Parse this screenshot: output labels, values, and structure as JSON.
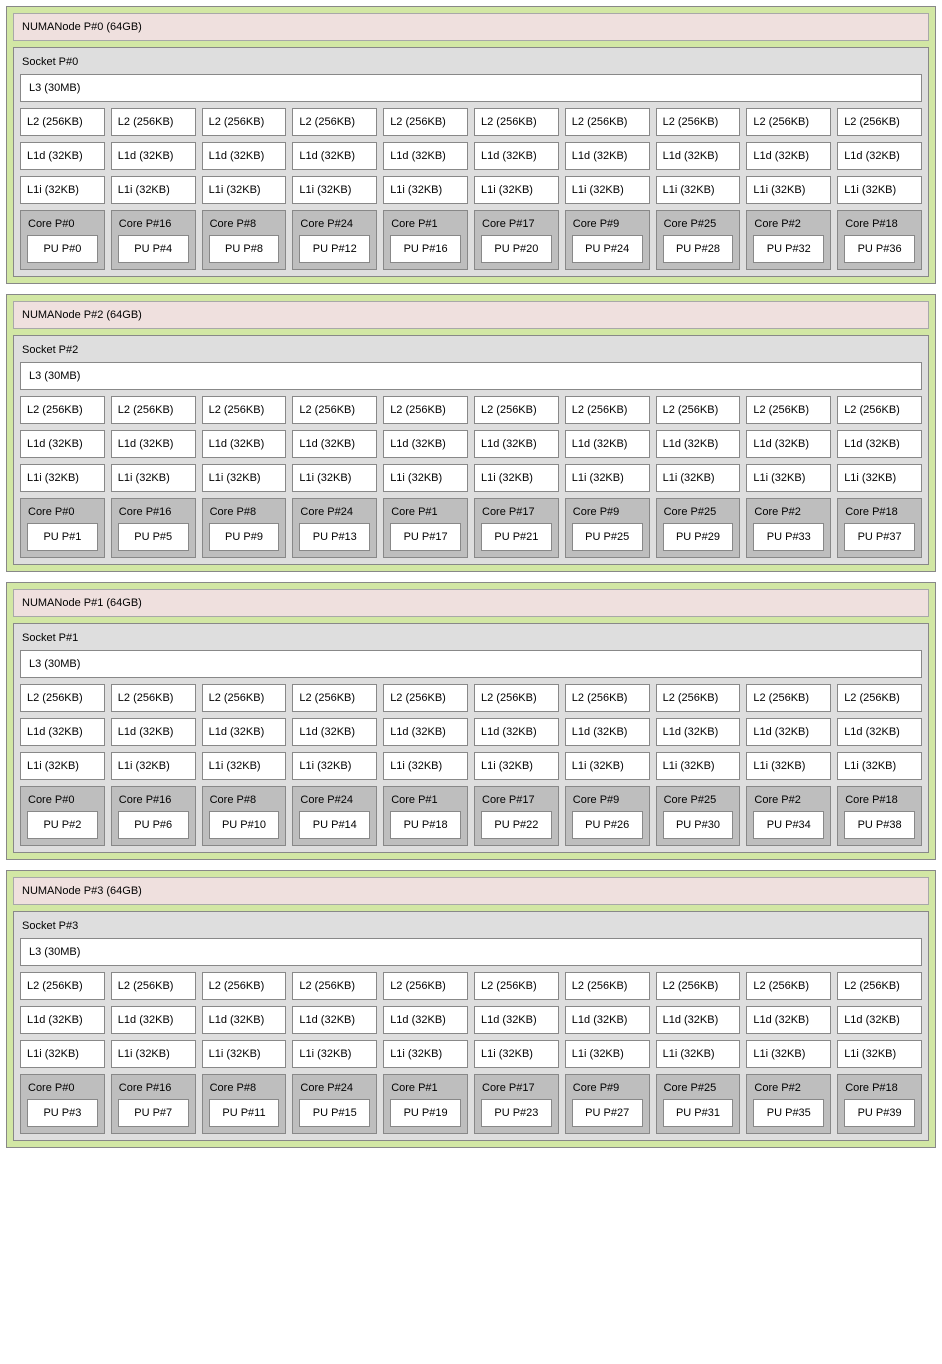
{
  "label_templates": {
    "numa": "NUMANode P#{n} ({mem})",
    "socket": "Socket P#{n}",
    "l3": "L3 ({size})",
    "l2": "L2 ({size})",
    "l1d": "L1d ({size})",
    "l1i": "L1i ({size})",
    "core": "Core P#{n}",
    "pu": "PU P#{n}"
  },
  "cache_sizes": {
    "l3": "30MB",
    "l2": "256KB",
    "l1d": "32KB",
    "l1i": "32KB"
  },
  "numa_memory": "64GB",
  "numa_order": [
    0,
    2,
    1,
    3
  ],
  "core_ids": [
    0,
    16,
    8,
    24,
    1,
    17,
    9,
    25,
    2,
    18
  ],
  "pu_map": {
    "0": [
      0,
      4,
      8,
      12,
      16,
      20,
      24,
      28,
      32,
      36
    ],
    "2": [
      1,
      5,
      9,
      13,
      17,
      21,
      25,
      29,
      33,
      37
    ],
    "1": [
      2,
      6,
      10,
      14,
      18,
      22,
      26,
      30,
      34,
      38
    ],
    "3": [
      3,
      7,
      11,
      15,
      19,
      23,
      27,
      31,
      35,
      39
    ]
  }
}
